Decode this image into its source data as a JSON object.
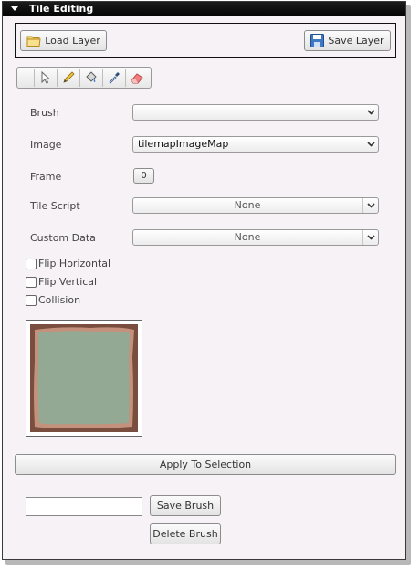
{
  "header": {
    "title": "Tile Editing"
  },
  "layer": {
    "load_label": "Load Layer",
    "save_label": "Save Layer"
  },
  "toolbar": {
    "tools": [
      "select-arrow-icon",
      "pencil-icon",
      "paint-bucket-icon",
      "eyedropper-icon",
      "eraser-icon"
    ]
  },
  "fields": {
    "brush": {
      "label": "Brush",
      "value": ""
    },
    "image": {
      "label": "Image",
      "value": "tilemapImageMap"
    },
    "frame": {
      "label": "Frame",
      "value": "0"
    },
    "tile_script": {
      "label": "Tile Script",
      "value": "None"
    },
    "custom_data": {
      "label": "Custom Data",
      "value": "None"
    }
  },
  "checkboxes": {
    "flip_horizontal": {
      "label": "Flip Horizontal",
      "checked": false
    },
    "flip_vertical": {
      "label": "Flip Vertical",
      "checked": false
    },
    "collision": {
      "label": "Collision",
      "checked": false
    }
  },
  "actions": {
    "apply_label": "Apply To Selection",
    "brush_name_value": "",
    "save_brush_label": "Save Brush",
    "delete_brush_label": "Delete Brush"
  },
  "colors": {
    "panel_bg": "#f7f2f6",
    "header_bg": "#0a0a0a",
    "tile_fill": "#93a994",
    "tile_border": "#7a4e3e",
    "tile_edge": "#c4917c"
  }
}
